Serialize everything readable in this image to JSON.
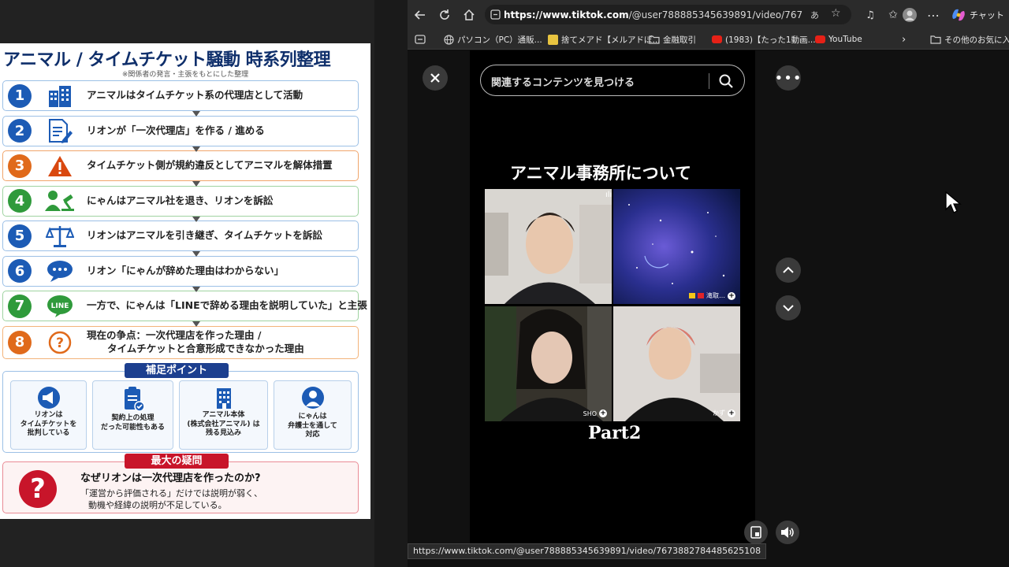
{
  "infographic": {
    "title": "アニマル / タイムチケット騒動 時系列整理",
    "subtitle": "※関係者の発言・主張をもとにした整理",
    "steps": [
      {
        "num": "1",
        "color": "#1c5bb5",
        "icon": "building-icon",
        "text": "アニマルはタイムチケット系の代理店として活動"
      },
      {
        "num": "2",
        "color": "#1c5bb5",
        "icon": "document-pen-icon",
        "text": "リオンが「一次代理店」を作る / 進める"
      },
      {
        "num": "3",
        "color": "#e06a1b",
        "icon": "warning-icon",
        "text": "タイムチケット側が規約違反としてアニマルを解体措置"
      },
      {
        "num": "4",
        "color": "#2f9a3b",
        "icon": "person-gavel-icon",
        "text": "にゃんはアニマル社を退き、リオンを訴訟"
      },
      {
        "num": "5",
        "color": "#1c5bb5",
        "icon": "scales-icon",
        "text": "リオンはアニマルを引き継ぎ、タイムチケットを訴訟"
      },
      {
        "num": "6",
        "color": "#1c5bb5",
        "icon": "speech-bubble-icon",
        "text": "リオン「にゃんが辞めた理由はわからない」"
      },
      {
        "num": "7",
        "color": "#2f9a3b",
        "icon": "line-logo-icon",
        "text": "一方で、にゃんは「LINEで辞める理由を説明していた」と主張"
      },
      {
        "num": "8",
        "color": "#e06a1b",
        "icon": "question-icon",
        "text": "現在の争点：一次代理店を作った理由 /",
        "text2": "タイムチケットと合意形成できなかった理由"
      }
    ],
    "points_label": "補足ポイント",
    "points": [
      {
        "icon": "megaphone-icon",
        "lines": [
          "リオンは",
          "タイムチケットを",
          "批判している"
        ]
      },
      {
        "icon": "contract-icon",
        "lines": [
          "契約上の処理",
          "だった可能性もある"
        ]
      },
      {
        "icon": "building-icon",
        "lines": [
          "アニマル本体",
          "(株式会社アニマル) は",
          "残る見込み"
        ]
      },
      {
        "icon": "person-icon",
        "lines": [
          "にゃんは",
          "弁護士を通して",
          "対応"
        ]
      }
    ],
    "question_label": "最大の疑問",
    "question_main": "なぜリオンは一次代理店を作ったのか?",
    "question_sub1": "「運営から評価される」だけでは説明が弱く、",
    "question_sub2": "動機や経緯の説明が不足している。"
  },
  "browser": {
    "url_host": "https://www.tiktok.com",
    "url_path": "/@user788885345639891/video/76738827844...",
    "chat_label": "チャット",
    "bookmarks": [
      {
        "label": "パソコン（PC）通販...",
        "icon": "globe-icon",
        "color": "#999999"
      },
      {
        "label": "捨てメアド【メルアドぽ...",
        "icon": "bookmark-icon",
        "color": "#e8c440"
      },
      {
        "label": "金融取引",
        "icon": "folder-icon",
        "color": "#cccccc"
      },
      {
        "label": "(1983)【たった1動画...",
        "icon": "youtube-icon",
        "color": "#e62117"
      },
      {
        "label": "YouTube",
        "icon": "youtube-icon",
        "color": "#e62117"
      }
    ],
    "bookmarks_overflow": "その他のお気に入り"
  },
  "tiktok": {
    "search_placeholder": "関連するコンテンツを見つける",
    "video_title": "アニマル事務所について",
    "part_label": "Part2",
    "participants": [
      {
        "name": "",
        "bg": "#d8d4cf"
      },
      {
        "name": "滝取…",
        "bg": "#1a2d6e"
      },
      {
        "name": "SHO",
        "bg": "#2a2a26"
      },
      {
        "name": "かず",
        "bg": "#d9d5d2"
      }
    ],
    "status_url": "https://www.tiktok.com/@user788885345639891/video/7673882784485625108"
  }
}
